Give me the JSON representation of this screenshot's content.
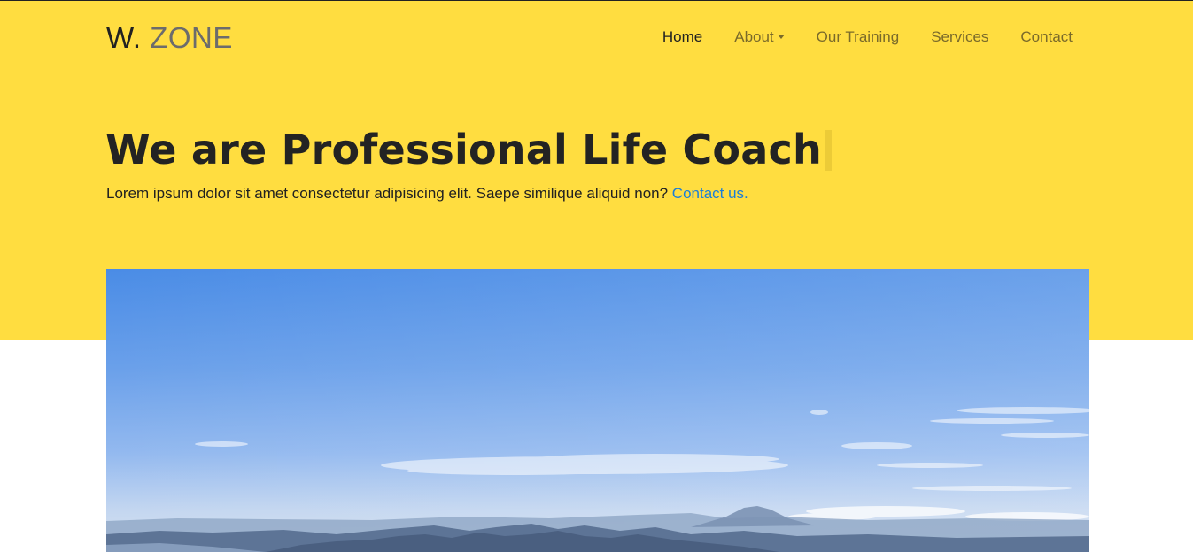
{
  "brand": {
    "first": "W.",
    "accent": "ZONE"
  },
  "nav": {
    "items": [
      {
        "label": "Home",
        "active": true
      },
      {
        "label": "About",
        "dropdown": true
      },
      {
        "label": "Our Training"
      },
      {
        "label": "Services"
      },
      {
        "label": "Contact"
      }
    ]
  },
  "hero": {
    "title": "We are Professional Life Coach",
    "subtitle": "Lorem ipsum dolor sit amet consectetur adipisicing elit. Saepe similique aliquid non?",
    "contact_link": "Contact us."
  },
  "colors": {
    "hero_background": "#ffdd40",
    "link": "#1a7ed8",
    "text_dark": "#212121",
    "nav_text": "#7a6a2a"
  }
}
